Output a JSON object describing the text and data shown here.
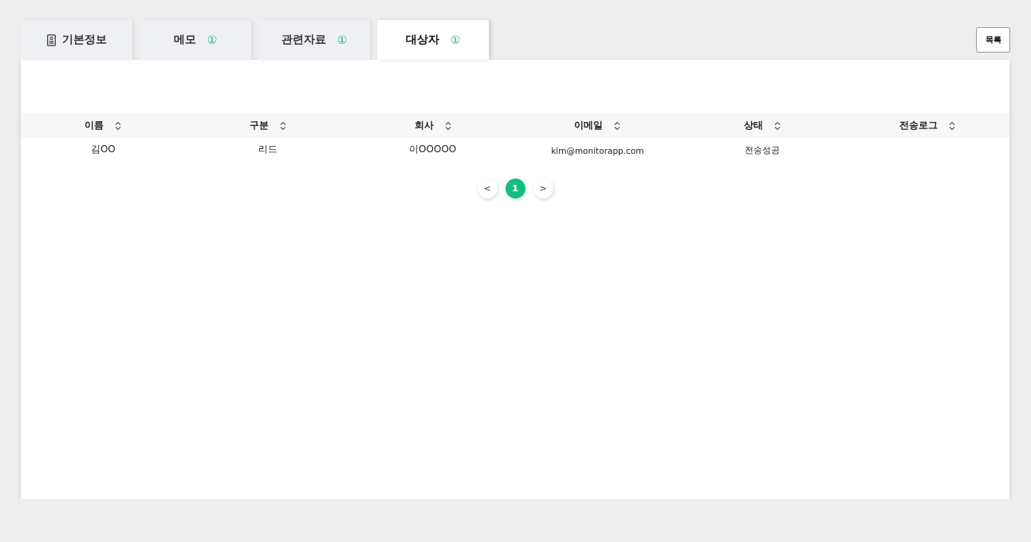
{
  "tabs": [
    {
      "label": "기본정보",
      "kind": "icon",
      "selected": false
    },
    {
      "label": "메모",
      "badge": "①",
      "kind": "badge",
      "selected": false
    },
    {
      "label": "관련자료",
      "badge": "①",
      "kind": "badge",
      "selected": false
    },
    {
      "label": "대상자",
      "badge": "①",
      "kind": "badge",
      "selected": true
    }
  ],
  "list_button": "목록",
  "table": {
    "columns": [
      "이름",
      "구분",
      "회사",
      "이메일",
      "상태",
      "전송로그"
    ],
    "rows": [
      [
        "김OO",
        "리드",
        "이OOOOO",
        "kim@monitorapp.com",
        "전송성공",
        ""
      ]
    ]
  },
  "pagination": {
    "prev": "<",
    "next": ">",
    "pages": [
      {
        "label": "1",
        "selected": true
      }
    ]
  }
}
